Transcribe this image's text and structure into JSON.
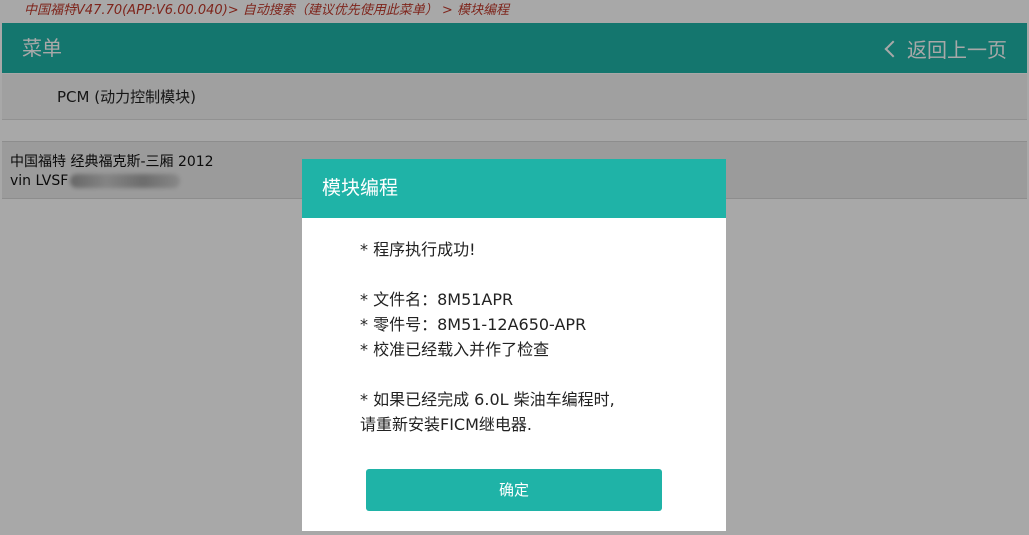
{
  "breadcrumb": "中国福特V47.70(APP:V6.00.040)> 自动搜索（建议优先使用此菜单） > 模块编程",
  "header": {
    "title": "菜单",
    "back_label": "返回上一页"
  },
  "module_item": "PCM (动力控制模块)",
  "vehicle_info": {
    "line1": "中国福特 经典福克斯-三厢 2012",
    "vin_prefix": "vin LVSF"
  },
  "dialog": {
    "title": "模块编程",
    "lines": [
      "* 程序执行成功!",
      "* 文件名：8M51APR",
      "* 零件号：8M51-12A650-APR",
      "* 校准已经载入并作了检查",
      "* 如果已经完成 6.0L 柴油车编程时,",
      "请重新安装FICM继电器."
    ],
    "ok_label": "确定"
  },
  "colors": {
    "accent": "#1fb3a7",
    "breadcrumb_text": "#c0392b"
  }
}
